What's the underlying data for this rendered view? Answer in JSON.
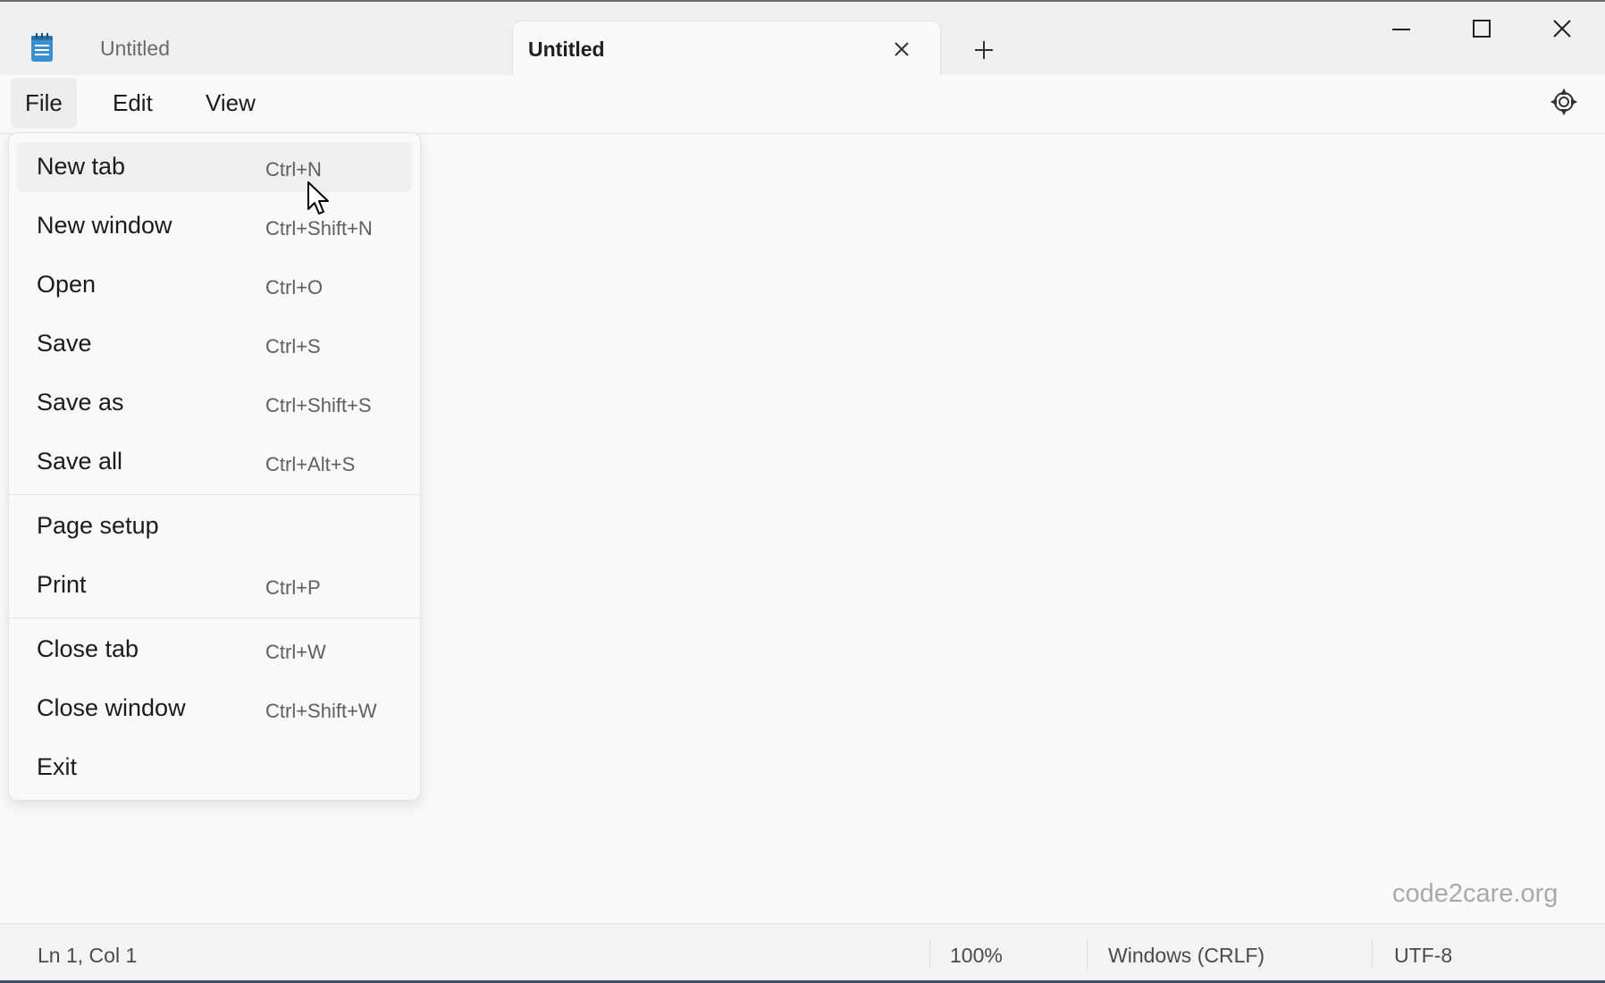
{
  "tabs": [
    {
      "label": "Untitled",
      "active": false
    },
    {
      "label": "Untitled",
      "active": true
    }
  ],
  "icons": {
    "app": "notepad-icon",
    "close_tab": "close-icon",
    "new_tab": "plus-icon",
    "minimize": "minimize-icon",
    "maximize": "maximize-icon",
    "close_window": "close-icon",
    "settings": "gear-icon"
  },
  "menubar": {
    "file": "File",
    "edit": "Edit",
    "view": "View"
  },
  "file_menu": {
    "groups": [
      [
        {
          "label": "New tab",
          "shortcut": "Ctrl+N",
          "hover": true
        },
        {
          "label": "New window",
          "shortcut": "Ctrl+Shift+N"
        },
        {
          "label": "Open",
          "shortcut": "Ctrl+O"
        },
        {
          "label": "Save",
          "shortcut": "Ctrl+S"
        },
        {
          "label": "Save as",
          "shortcut": "Ctrl+Shift+S"
        },
        {
          "label": "Save all",
          "shortcut": "Ctrl+Alt+S"
        }
      ],
      [
        {
          "label": "Page setup",
          "shortcut": ""
        },
        {
          "label": "Print",
          "shortcut": "Ctrl+P"
        }
      ],
      [
        {
          "label": "Close tab",
          "shortcut": "Ctrl+W"
        },
        {
          "label": "Close window",
          "shortcut": "Ctrl+Shift+W"
        },
        {
          "label": "Exit",
          "shortcut": ""
        }
      ]
    ]
  },
  "status": {
    "position": "Ln 1, Col 1",
    "zoom": "100%",
    "line_ending": "Windows (CRLF)",
    "encoding": "UTF-8"
  },
  "watermark": "code2care.org",
  "colors": {
    "app_icon": "#3a8fd1",
    "titlebar": "#efefef",
    "background": "#f9f9f9"
  }
}
